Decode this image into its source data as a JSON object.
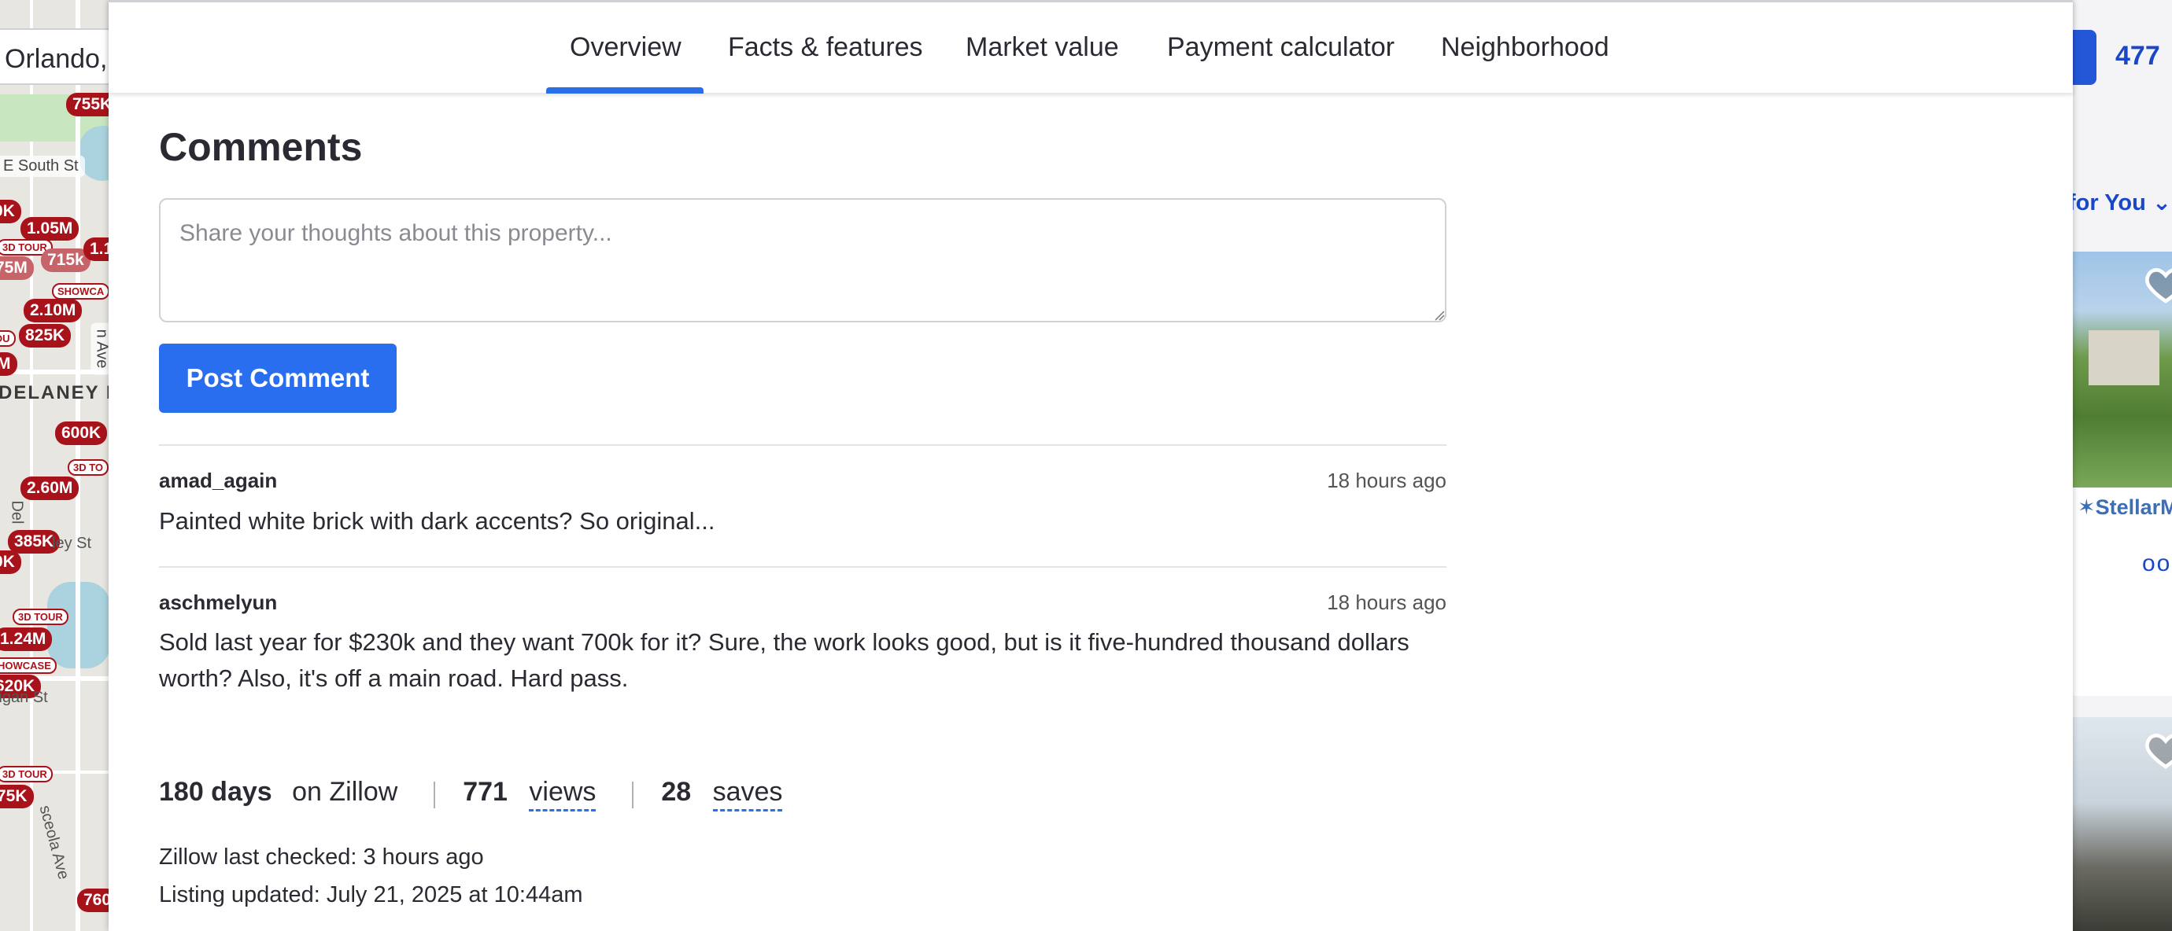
{
  "background": {
    "search_value": "Orlando,",
    "map_streets": [
      "E South St",
      "DELANEY P",
      "Del",
      "ley St",
      "ligan St",
      "sceola Ave",
      "n Ave"
    ],
    "map_pins": [
      "755K",
      "1.05M",
      "0K",
      "715k",
      "75M",
      "1.1",
      "2.10M",
      "825K",
      "M",
      "600K",
      "2.60M",
      "385K",
      "0K",
      "1.24M",
      "620K",
      "75K",
      "760"
    ],
    "map_tags": [
      "3D TOUR",
      "SHOWCA",
      "3D TO",
      "3D TOUR",
      "HOWCASE",
      "3D TOUR",
      "OU"
    ],
    "result_count": "477",
    "for_you_label": "for You",
    "stellar_label": "StellarML",
    "dots": "ooo"
  },
  "tabs": [
    {
      "label": "Overview",
      "active": true
    },
    {
      "label": "Facts & features",
      "active": false
    },
    {
      "label": "Market value",
      "active": false
    },
    {
      "label": "Payment calculator",
      "active": false
    },
    {
      "label": "Neighborhood",
      "active": false
    }
  ],
  "comments_section": {
    "title": "Comments",
    "input_placeholder": "Share your thoughts about this property...",
    "input_value": "",
    "post_button_label": "Post Comment",
    "comments": [
      {
        "user": "amad_again",
        "time": "18 hours ago",
        "text": "Painted white brick with dark accents? So original..."
      },
      {
        "user": "aschmelyun",
        "time": "18 hours ago",
        "text": "Sold last year for $230k and they want 700k for it? Sure, the work looks good, but is it five-hundred thousand dollars worth? Also, it's off a main road. Hard pass."
      }
    ]
  },
  "stats": {
    "days": "180 days",
    "days_suffix": "on Zillow",
    "views_count": "771",
    "views_label": "views",
    "saves_count": "28",
    "saves_label": "saves"
  },
  "meta": {
    "last_checked": "Zillow last checked: 3 hours ago",
    "listing_updated": "Listing updated: July 21, 2025 at 10:44am"
  },
  "colors": {
    "accent": "#2a6ef0",
    "pin_red": "#a8131b",
    "text": "#2a2a33"
  }
}
